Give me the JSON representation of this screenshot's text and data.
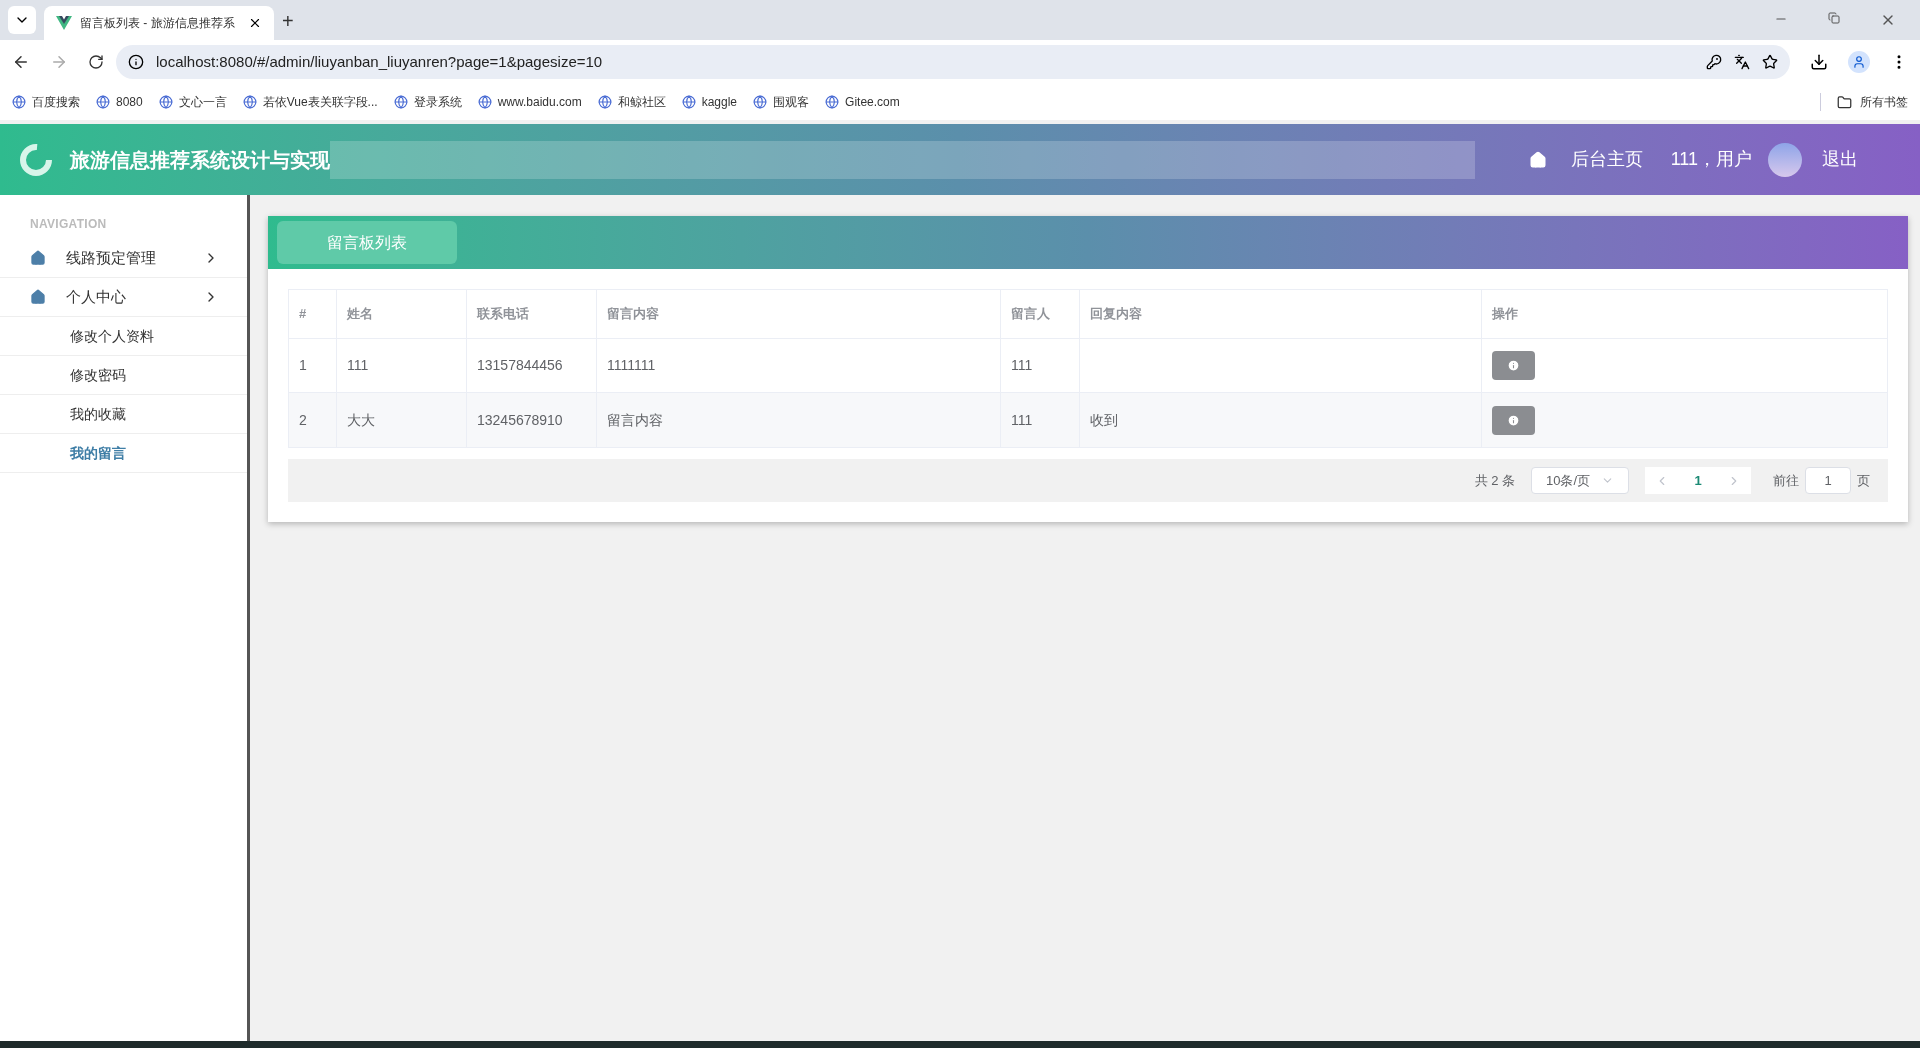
{
  "browser": {
    "tab_title": "留言板列表 - 旅游信息推荐系",
    "new_tab": "+",
    "address": "localhost:8080/#/admin/liuyanban_liuyanren?page=1&pagesize=10",
    "bookmarks": [
      "百度搜索",
      "8080",
      "文心一言",
      "若依Vue表关联字段...",
      "登录系统",
      "www.baidu.com",
      "和鲸社区",
      "kaggle",
      "围观客",
      "Gitee.com"
    ],
    "all_bookmarks": "所有书签"
  },
  "header": {
    "title": "旅游信息推荐系统设计与实现",
    "home_link": "后台主页",
    "user": "111，用户",
    "logout": "退出"
  },
  "sidebar": {
    "heading": "NAVIGATION",
    "items": [
      {
        "label": "线路预定管理"
      },
      {
        "label": "个人中心",
        "children": [
          {
            "label": "修改个人资料",
            "selected": false
          },
          {
            "label": "修改密码",
            "selected": false
          },
          {
            "label": "我的收藏",
            "selected": false
          },
          {
            "label": "我的留言",
            "selected": true
          }
        ]
      }
    ]
  },
  "card": {
    "title": "留言板列表"
  },
  "table": {
    "columns": [
      "#",
      "姓名",
      "联系电话",
      "留言内容",
      "留言人",
      "回复内容",
      "操作"
    ],
    "rows": [
      {
        "cells": [
          "1",
          "111",
          "13157844456",
          "1111111",
          "111",
          ""
        ]
      },
      {
        "cells": [
          "2",
          "大大",
          "13245678910",
          "留言内容",
          "111",
          "收到"
        ]
      }
    ]
  },
  "pagination": {
    "total": "共 2 条",
    "page_size": "10条/页",
    "pages": [
      {
        "label": "1",
        "selected": true
      }
    ],
    "goto_label": "前往",
    "goto_value": "1",
    "goto_suffix": "页"
  }
}
